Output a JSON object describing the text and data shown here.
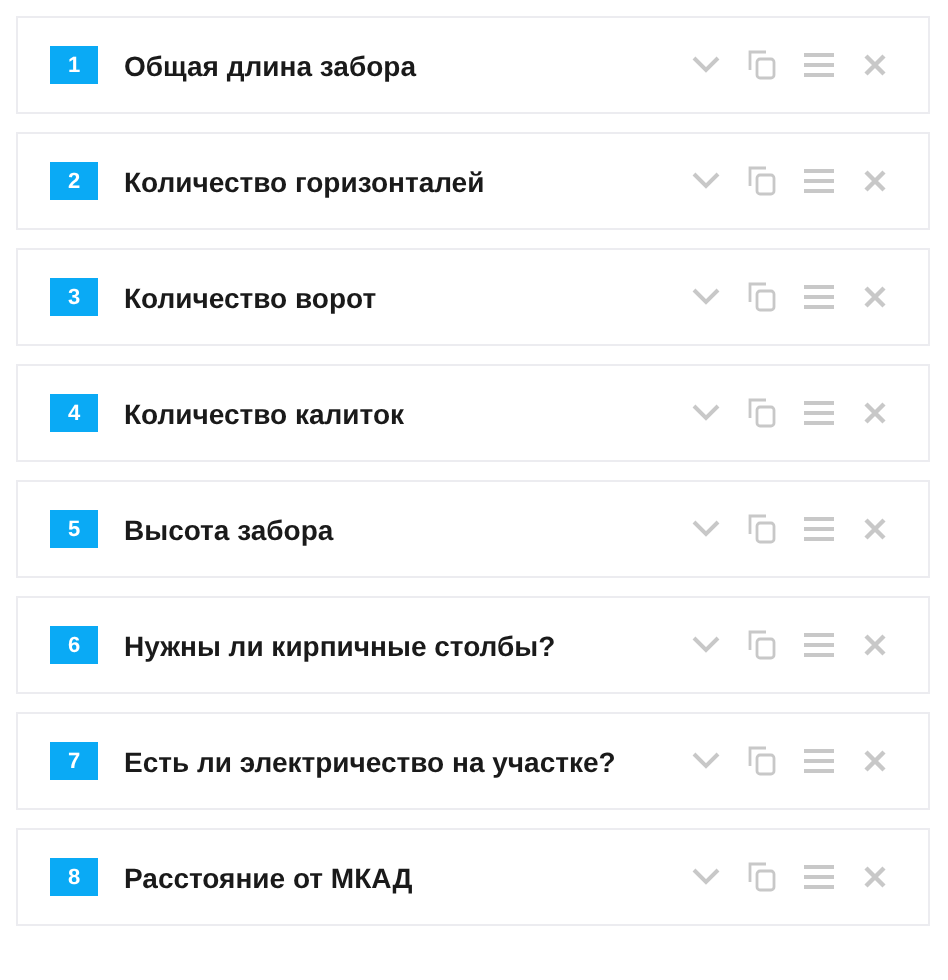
{
  "questions": [
    {
      "number": "1",
      "title": "Общая длина забора"
    },
    {
      "number": "2",
      "title": "Количество горизонталей"
    },
    {
      "number": "3",
      "title": "Количество ворот"
    },
    {
      "number": "4",
      "title": "Количество калиток"
    },
    {
      "number": "5",
      "title": "Высота забора"
    },
    {
      "number": "6",
      "title": "Нужны ли кирпичные столбы?"
    },
    {
      "number": "7",
      "title": "Есть ли электричество на участке?"
    },
    {
      "number": "8",
      "title": "Расстояние от МКАД"
    }
  ]
}
